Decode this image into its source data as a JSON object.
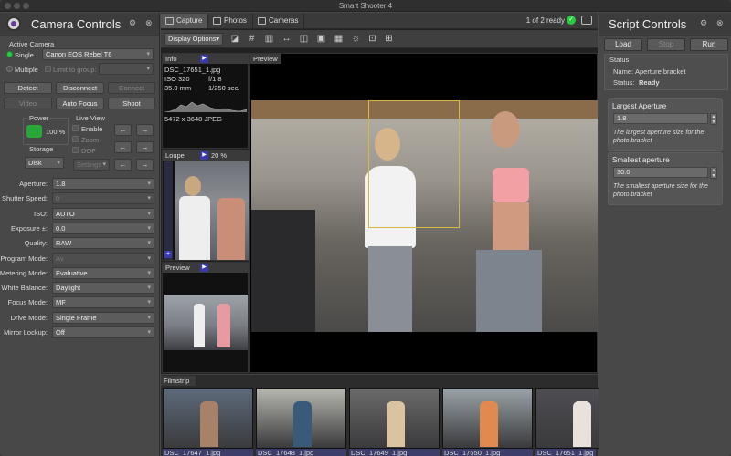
{
  "window": {
    "title": "Smart Shooter 4"
  },
  "left": {
    "title": "Camera Controls",
    "active_camera_label": "Active Camera",
    "single_label": "Single",
    "camera_model": "Canon EOS Rebel T6",
    "multiple_label": "Multiple",
    "limit_group_label": "Limit to group:",
    "buttons": {
      "detect": "Detect",
      "disconnect": "Disconnect",
      "connect": "Connect",
      "video": "Video",
      "autofocus": "Auto Focus",
      "shoot": "Shoot"
    },
    "power_label": "Power",
    "power_value": "100 %",
    "liveview_label": "Live View",
    "enable_label": "Enable",
    "zoom_label": "Zoom",
    "dof_label": "DOF",
    "settings_label": "Settings",
    "storage_label": "Storage",
    "storage_value": "Disk",
    "settings": [
      {
        "label": "Aperture:",
        "value": "1.8",
        "disabled": false
      },
      {
        "label": "Shutter Speed:",
        "value": "0",
        "disabled": true
      },
      {
        "label": "ISO:",
        "value": "AUTO",
        "disabled": false
      },
      {
        "label": "Exposure ±:",
        "value": "0.0",
        "disabled": false
      },
      {
        "label": "Quality:",
        "value": "RAW",
        "disabled": false
      },
      {
        "label": "Program Mode:",
        "value": "Av",
        "disabled": true
      },
      {
        "label": "Metering Mode:",
        "value": "Evaluative",
        "disabled": false
      },
      {
        "label": "White Balance:",
        "value": "Daylight",
        "disabled": false
      },
      {
        "label": "Focus Mode:",
        "value": "MF",
        "disabled": false
      },
      {
        "label": "Drive Mode:",
        "value": "Single Frame",
        "disabled": false
      },
      {
        "label": "Mirror Lockup:",
        "value": "Off",
        "disabled": false
      }
    ]
  },
  "center": {
    "tabs": [
      "Capture",
      "Photos",
      "Cameras"
    ],
    "ready_text": "1 of 2 ready",
    "display_options": "Display Options",
    "info": {
      "title": "Info",
      "filename": "DSC_17651_1.jpg",
      "iso": "ISO 320",
      "aperture": "f/1.8",
      "focal": "35.0 mm",
      "shutter": "1/250 sec.",
      "dimensions": "5472 x 3648 JPEG"
    },
    "loupe": {
      "title": "Loupe",
      "zoom": "20 %"
    },
    "small_preview_title": "Preview",
    "preview_title": "Preview",
    "filmstrip": {
      "title": "Filmstrip",
      "items": [
        "DSC_17647_1.jpg",
        "DSC_17648_1.jpg",
        "DSC_17649_1.jpg",
        "DSC_17650_1.jpg",
        "DSC_17651_1.jpg"
      ]
    }
  },
  "right": {
    "title": "Script Controls",
    "buttons": {
      "load": "Load",
      "stop": "Stop",
      "run": "Run"
    },
    "status_label": "Status",
    "name_label": "Name:",
    "name_value": "Aperture bracket",
    "status_key": "Status:",
    "status_value": "Ready",
    "largest": {
      "title": "Largest Aperture",
      "value": "1.8",
      "help": "The largest aperture size for the photo bracket"
    },
    "smallest": {
      "title": "Smallest aperture",
      "value": "30.0",
      "help": "The smallest aperture size for the photo bracket"
    }
  },
  "colors": {
    "green": "#29c940",
    "accent_blue": "#3a3aaa",
    "panel": "#484848"
  }
}
